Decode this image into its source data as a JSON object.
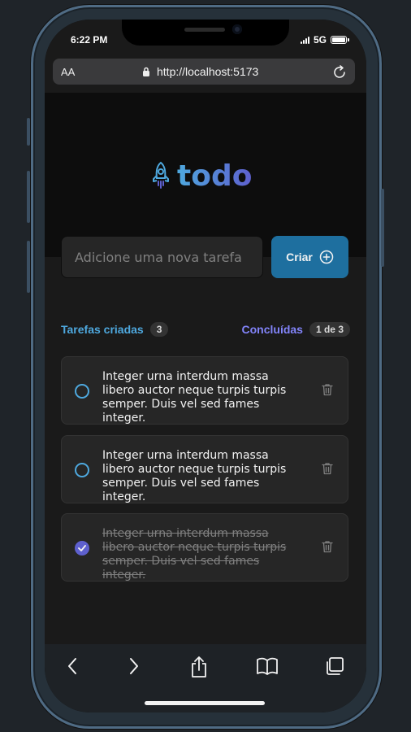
{
  "status_bar": {
    "time": "6:22 PM",
    "network": "5G"
  },
  "browser": {
    "aa_label": "AA",
    "url": "http://localhost:5173"
  },
  "app": {
    "logo_text": "todo",
    "new_task_placeholder": "Adicione uma nova tarefa",
    "create_label": "Criar",
    "created_label": "Tarefas criadas",
    "created_count": "3",
    "done_label": "Concluídas",
    "done_count": "1 de 3",
    "tasks": [
      {
        "text": "Integer urna interdum massa libero auctor neque turpis turpis semper. Duis vel sed fames integer.",
        "done": false
      },
      {
        "text": "Integer urna interdum massa libero auctor neque turpis turpis semper. Duis vel sed fames integer.",
        "done": false
      },
      {
        "text": "Integer urna interdum massa libero auctor neque turpis turpis semper. Duis vel sed fames integer.",
        "done": true
      }
    ]
  },
  "colors": {
    "blue": "#4ea8de",
    "blue_dark": "#1e6f9f",
    "purple": "#8284fa",
    "purple_dark": "#5e60ce"
  }
}
